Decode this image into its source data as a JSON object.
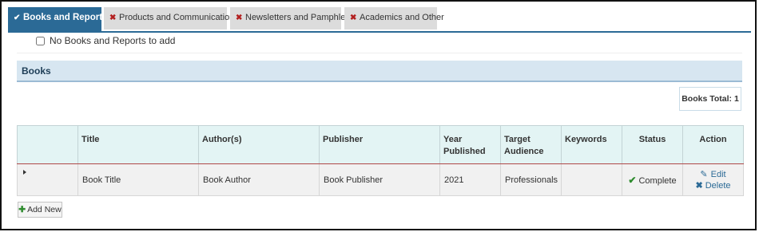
{
  "tabs": [
    {
      "label": "Books and Reports",
      "icon": "check-icon",
      "active": true
    },
    {
      "label": "Products and Communications",
      "icon": "x-icon",
      "active": false
    },
    {
      "label": "Newsletters and Pamphlets",
      "icon": "x-icon",
      "active": false
    },
    {
      "label": "Academics and Other",
      "icon": "x-icon",
      "active": false
    }
  ],
  "no_add": {
    "label": "No Books and Reports to add",
    "checked": false
  },
  "section": {
    "title": "Books"
  },
  "total": {
    "label": "Books Total: 1"
  },
  "table": {
    "headers": [
      "",
      "Title",
      "Author(s)",
      "Publisher",
      "Year Published",
      "Target Audience",
      "Keywords",
      "Status",
      "Action"
    ],
    "rows": [
      {
        "title": "Book Title",
        "authors": "Book Author",
        "publisher": "Book Publisher",
        "year": "2021",
        "audience": "Professionals",
        "keywords": "",
        "status": "Complete",
        "edit_label": "Edit",
        "delete_label": "Delete"
      }
    ]
  },
  "add_new": {
    "label": "Add New"
  },
  "colors": {
    "accent": "#2b6a96",
    "inactive_tab": "#dcdcdc",
    "x_mark": "#b32020",
    "success": "#2e8b2e",
    "header_band": "#d7e6f1",
    "table_head": "#e3f4f4"
  }
}
